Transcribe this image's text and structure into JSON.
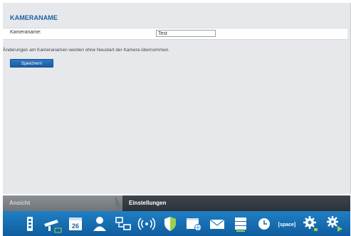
{
  "section": {
    "title": "KAMERANAME",
    "field_label": "Kameraname:",
    "field_value": "Test",
    "note": "Änderungen am Kameranamen werden ohne Neustart der Kamera übernommen.",
    "save_label": "Speichern"
  },
  "tabs": [
    {
      "label": "Ansicht",
      "active": false
    },
    {
      "label": "Einstellungen",
      "active": true
    }
  ],
  "toolbar": {
    "calendar_day": "26",
    "space_label": "[space]",
    "icons": [
      "door-station-icon",
      "camera-icon",
      "calendar-icon",
      "user-icon",
      "network-icon",
      "wifi-icon",
      "shield-icon",
      "web-icon",
      "mail-icon",
      "storage-icon",
      "clock-icon",
      "space-icon",
      "settings-icon",
      "settings-play-icon"
    ]
  },
  "colors": {
    "accent": "#1f5fa0",
    "toolbar": "#1f7fc4",
    "content_bg": "#e6e8eb"
  }
}
